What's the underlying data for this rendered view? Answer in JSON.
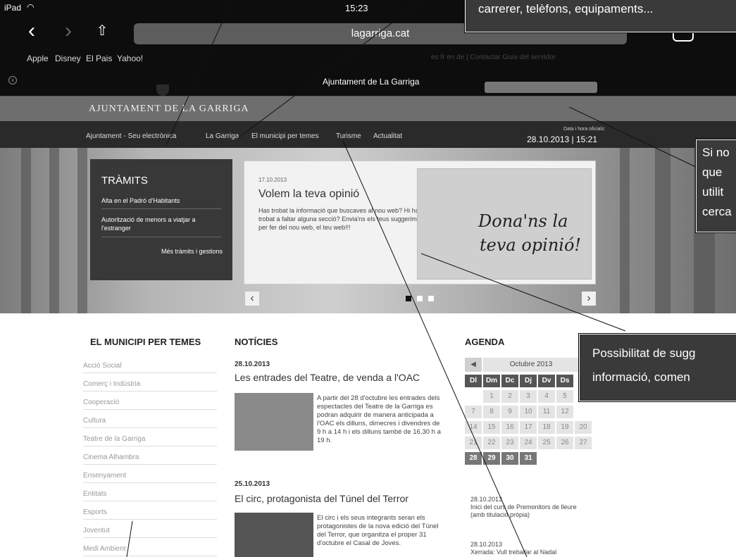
{
  "status": {
    "device": "iPad",
    "time": "15:23"
  },
  "browser": {
    "url": "lagarriga.cat",
    "tab_title": "Ajuntament de La Garriga",
    "bookmarks": [
      "Apple",
      "Disney",
      "El Pais",
      "Yahoo!"
    ],
    "faded_links": "es fr en de | Contactar  Guia del servidor"
  },
  "site": {
    "banner": "AJUNTAMENT DE LA GARRIGA",
    "nav": [
      "Ajuntament - Seu electrònica",
      "La Garriga",
      "El municipi per temes",
      "Turisme",
      "Actualitat"
    ],
    "datetime_label": "Data i hora oficials:",
    "datetime": "28.10.2013 | 15:21"
  },
  "tramits": {
    "title": "TRÀMITS",
    "items": [
      "Alta en el Padró d'Habitants",
      "Autorització de menors a viatjar a l'estranger"
    ],
    "more": "Més tràmits i gestions"
  },
  "slide": {
    "date": "17.10.2013",
    "title": "Volem la teva opinió",
    "text": "Has trobat la informació que buscaves al nou web? Hi has trobat a faltar alguna secció? Envia'ns els teus suggeriments per fer del nou web, el teu web!!!",
    "image_text_1": "Dona'ns la",
    "image_text_2": "teva opinió!"
  },
  "temes": {
    "title": "EL MUNICIPI PER TEMES",
    "items": [
      "Acció Social",
      "Comerç i Indústria",
      "Cooperació",
      "Cultura",
      "Teatre de la Garriga",
      "Cinema Alhambra",
      "Ensenyament",
      "Entitats",
      "Esports",
      "Joventut",
      "Medi Ambient"
    ]
  },
  "noticies": {
    "title": "NOTÍCIES",
    "items": [
      {
        "date": "28.10.2013",
        "title": "Les entrades del Teatre, de venda a l'OAC",
        "text": "A partir del 28 d'octubre les entrades dels espectacles del Teatre de la Garriga es podran adquirir de manera anticipada a l'OAC els dilluns, dimecres i divendres de 9 h a 14 h i els dilluns també de 16.30 h a 19 h."
      },
      {
        "date": "25.10.2013",
        "title": "El circ, protagonista del Túnel del Terror",
        "text": "El circ i els seus integrants seran els protagonistes de la nova edició del Túnel del Terror, que organitza el proper 31 d'octubre el Casal de Joves."
      }
    ]
  },
  "agenda": {
    "title": "AGENDA",
    "month": "Octubre 2013",
    "weekdays": [
      "Dl",
      "Dm",
      "Dc",
      "Dj",
      "Dv",
      "Ds"
    ],
    "weeks": [
      [
        "",
        "1",
        "2",
        "3",
        "4",
        "5"
      ],
      [
        "7",
        "8",
        "9",
        "10",
        "11",
        "12"
      ],
      [
        "14",
        "15",
        "16",
        "17",
        "18",
        "19",
        "20"
      ],
      [
        "21",
        "22",
        "23",
        "24",
        "25",
        "26",
        "27"
      ],
      [
        "28",
        "29",
        "30",
        "31"
      ]
    ],
    "events": [
      {
        "date": "28.10.2013",
        "text": "Inici del curs de Premonitors de lleure (amb titulació pròpia)"
      },
      {
        "date": "28.10.2013",
        "text": "Xerrada: Vull treballar al Nadal"
      }
    ]
  },
  "callouts": {
    "top": "carrerer, telèfons, equipaments...",
    "search": [
      "Si no",
      "que",
      "utilit",
      "cerca"
    ],
    "suggest": [
      "Possibilitat de sugg",
      "informació, comen"
    ]
  },
  "colors": {
    "chrome": "#0d0d0d",
    "banner": "#6e6e6e",
    "nav": "#2a2a2a",
    "callout": "#3a3a3a"
  }
}
